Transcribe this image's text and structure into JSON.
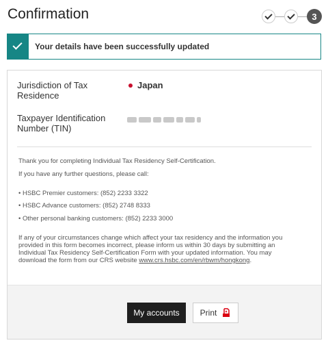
{
  "page": {
    "title": "Confirmation"
  },
  "stepper": {
    "steps_completed": 2,
    "current_step": "3"
  },
  "banner": {
    "message": "Your details have been successfully updated"
  },
  "details": {
    "jurisdiction_label_line1": "Jurisdiction of Tax",
    "jurisdiction_label_line2": "Residence",
    "jurisdiction_value": "Japan",
    "tin_label_line1": "Taxpayer Identification",
    "tin_label_line2": "Number (TIN)"
  },
  "message": {
    "thanks": "Thank you for completing Individual Tax Residency Self-Certification.",
    "questions": "If you have any further questions, please call:",
    "contacts": [
      "• HSBC Premier customers: (852) 2233 3322",
      "• HSBC Advance customers: (852) 2748 8333",
      "• Other personal banking customers: (852) 2233 3000"
    ],
    "notice_line1": "If any of your circumstances change which affect your tax residency and the information you",
    "notice_line2": "provided in this form becomes incorrect, please inform us within 30 days by submitting an",
    "notice_line3": "Individual Tax Residency Self-Certification Form with your updated information. You may",
    "notice_line4_prefix": "download the form from our CRS website ",
    "notice_link": "www.crs.hsbc.com/en/rbwm/hongkong",
    "notice_line4_suffix": "."
  },
  "actions": {
    "my_accounts_label": "My accounts",
    "print_label": "Print"
  },
  "colors": {
    "success_accent": "#168685",
    "primary_button": "#1f1f1f",
    "pdf_icon": "#db0011"
  }
}
